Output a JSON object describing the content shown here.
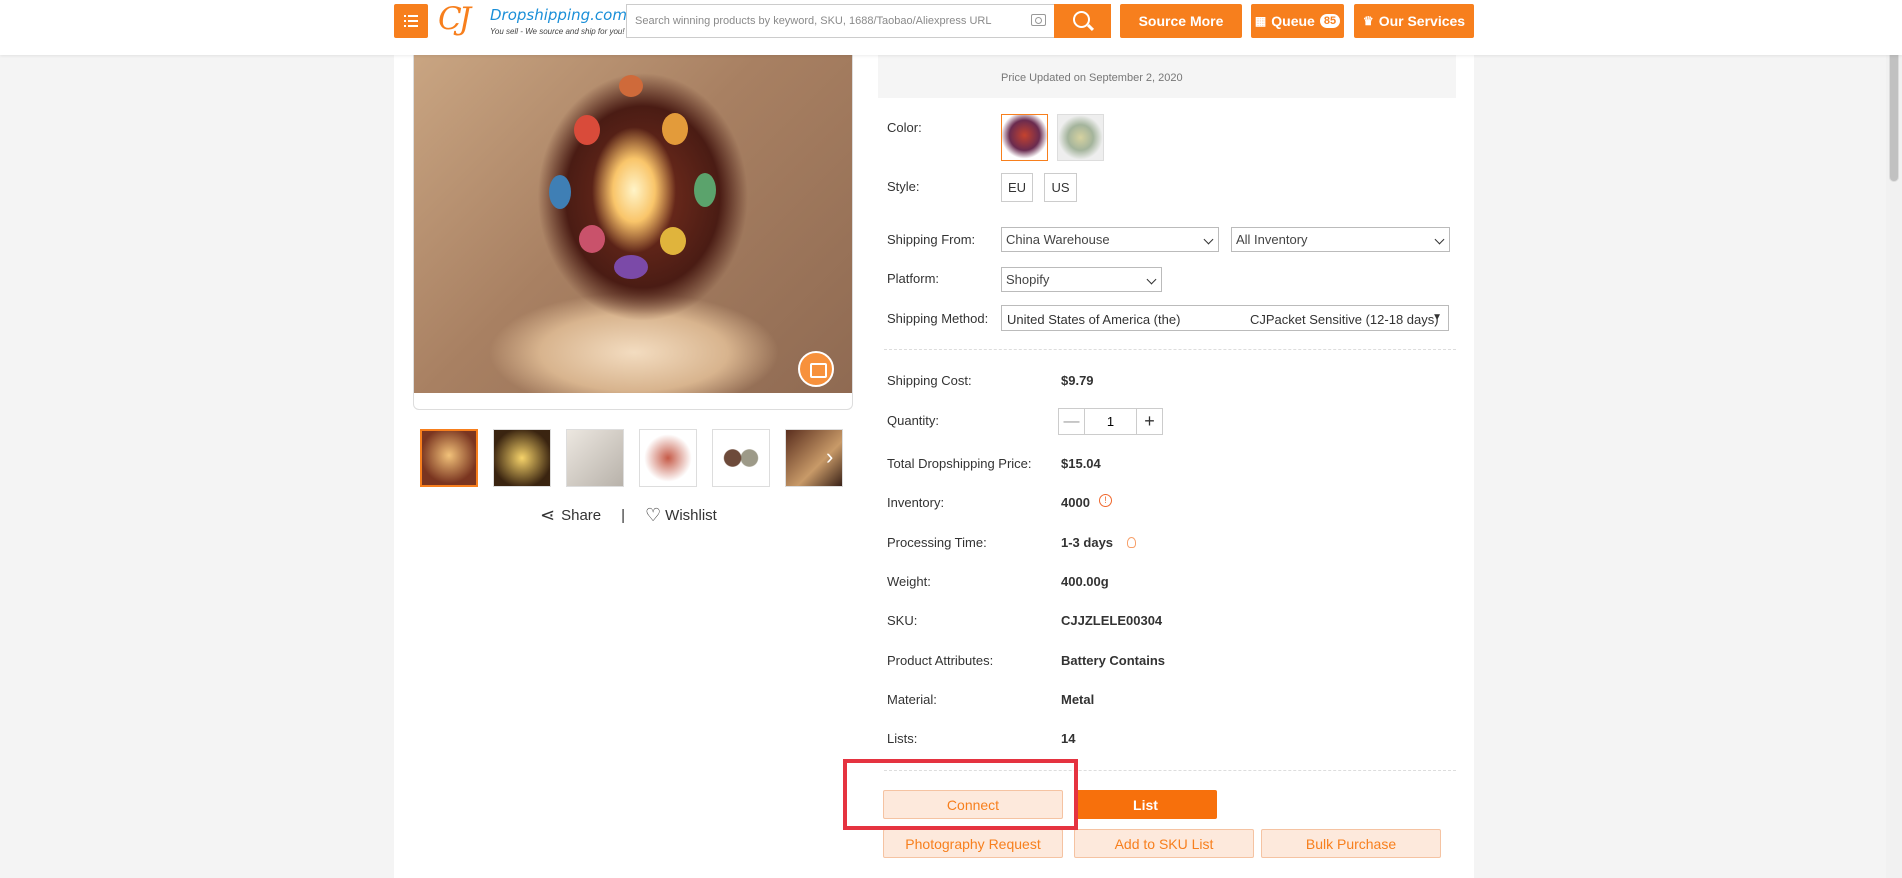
{
  "header": {
    "logo_mark": "CJ",
    "logo_brand": "Dropshipping.com",
    "logo_tagline": "You sell - We source and ship for you!",
    "search_placeholder": "Search winning products by keyword, SKU, 1688/Taobao/Aliexpress URL",
    "source_more": "Source More",
    "queue": "Queue",
    "queue_count": "85",
    "our_services": "Our Services"
  },
  "product": {
    "price_updated": "Price Updated on September 2, 2020",
    "color_label": "Color:",
    "style_label": "Style:",
    "styles": [
      "EU",
      "US"
    ],
    "shipping_from_label": "Shipping From:",
    "shipping_from_value": "China Warehouse",
    "inventory_filter_value": "All Inventory",
    "platform_label": "Platform:",
    "platform_value": "Shopify",
    "shipping_method_label": "Shipping Method:",
    "shipping_country": "United States of America (the)",
    "shipping_method": "CJPacket Sensitive (12-18 days)",
    "shipping_cost_label": "Shipping Cost:",
    "shipping_cost": "$9.79",
    "quantity_label": "Quantity:",
    "quantity_value": "1",
    "qty_minus": "—",
    "qty_plus": "+",
    "total_price_label": "Total Dropshipping Price:",
    "total_price": "$15.04",
    "inventory_label": "Inventory:",
    "inventory": "4000",
    "processing_label": "Processing Time:",
    "processing": "1-3 days",
    "weight_label": "Weight:",
    "weight": "400.00g",
    "sku_label": "SKU:",
    "sku": "CJJZLELE00304",
    "attributes_label": "Product Attributes:",
    "attributes": "Battery Contains",
    "material_label": "Material:",
    "material": "Metal",
    "lists_label": "Lists:",
    "lists": "14"
  },
  "gallery": {
    "share": "Share",
    "separator": "|",
    "wishlist": "Wishlist"
  },
  "actions": {
    "connect": "Connect",
    "list": "List",
    "photography": "Photography Request",
    "add_sku": "Add to SKU List",
    "bulk": "Bulk Purchase"
  },
  "colors": {
    "accent": "#f77f1d",
    "highlight": "#e53340"
  }
}
